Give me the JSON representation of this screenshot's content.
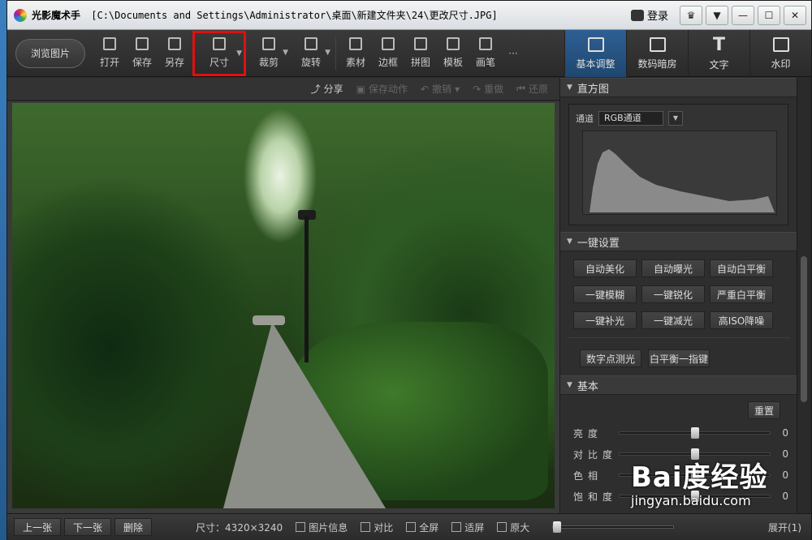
{
  "window": {
    "app_name": "光影魔术手",
    "file_path": "[C:\\Documents and Settings\\Administrator\\桌面\\新建文件夹\\24\\更改尺寸.JPG]",
    "login_label": "登录",
    "controls": {
      "skin": "♛",
      "menu": "▼",
      "minimize": "—",
      "maximize": "☐",
      "close": "✕"
    }
  },
  "toolbar": {
    "browse_label": "浏览图片",
    "tools": [
      {
        "label": "打开"
      },
      {
        "label": "保存"
      },
      {
        "label": "另存"
      },
      {
        "label": "尺寸"
      },
      {
        "label": "裁剪"
      },
      {
        "label": "旋转"
      },
      {
        "label": "素材"
      },
      {
        "label": "边框"
      },
      {
        "label": "拼图"
      },
      {
        "label": "模板"
      },
      {
        "label": "画笔"
      }
    ],
    "more_label": "···",
    "right_tabs": [
      {
        "label": "基本调整"
      },
      {
        "label": "数码暗房"
      },
      {
        "label": "文字",
        "glyph": "T"
      },
      {
        "label": "水印"
      }
    ]
  },
  "actions": {
    "share": "分享",
    "save_action": "保存动作",
    "undo": "撤销",
    "redo": "重做",
    "restore": "还原"
  },
  "panel": {
    "histogram": {
      "title": "直方图",
      "channel_label": "通道",
      "channel_value": "RGB通道"
    },
    "one_click": {
      "title": "一键设置",
      "buttons": [
        "自动美化",
        "自动曝光",
        "自动白平衡",
        "一键模糊",
        "一键锐化",
        "严重白平衡",
        "一键补光",
        "一键减光",
        "高ISO降噪"
      ],
      "extra_buttons": [
        "数字点测光",
        "白平衡一指键"
      ]
    },
    "basic": {
      "title": "基本",
      "reset_label": "重置",
      "sliders": [
        {
          "label": "亮度",
          "value": "0",
          "level": 0.5
        },
        {
          "label": "对比度",
          "value": "0",
          "level": 0.5
        },
        {
          "label": "色相",
          "value": "0",
          "level": 0.5
        },
        {
          "label": "饱和度",
          "value": "0",
          "level": 0.5
        }
      ]
    }
  },
  "bottom": {
    "prev": "上一张",
    "next": "下一张",
    "delete": "删除",
    "size_text": "尺寸：4320×3240",
    "info": "图片信息",
    "compare": "对比",
    "fullscreen": "全屏",
    "fit": "适屏",
    "original": "原大",
    "expand": "展开(1)"
  },
  "watermark": {
    "logo": "Bai度经验",
    "url": "jingyan.baidu.com"
  }
}
